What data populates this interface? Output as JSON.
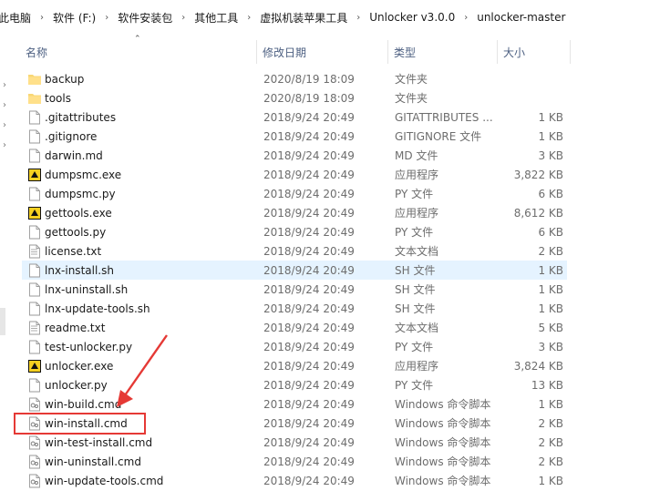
{
  "breadcrumb": [
    "此电脑",
    "软件 (F:)",
    "软件安装包",
    "其他工具",
    "虚拟机装苹果工具",
    "Unlocker v3.0.0",
    "unlocker-master"
  ],
  "columns": {
    "name": "名称",
    "date": "修改日期",
    "type": "类型",
    "size": "大小"
  },
  "files": [
    {
      "name": "backup",
      "date": "2020/8/19 18:09",
      "type": "文件夹",
      "size": "",
      "icon": "folder-icon"
    },
    {
      "name": "tools",
      "date": "2020/8/19 18:09",
      "type": "文件夹",
      "size": "",
      "icon": "folder-icon"
    },
    {
      "name": ".gitattributes",
      "date": "2018/9/24 20:49",
      "type": "GITATTRIBUTES ...",
      "size": "1 KB",
      "icon": "file-icon"
    },
    {
      "name": ".gitignore",
      "date": "2018/9/24 20:49",
      "type": "GITIGNORE 文件",
      "size": "1 KB",
      "icon": "file-icon"
    },
    {
      "name": "darwin.md",
      "date": "2018/9/24 20:49",
      "type": "MD 文件",
      "size": "3 KB",
      "icon": "file-icon"
    },
    {
      "name": "dumpsmc.exe",
      "date": "2018/9/24 20:49",
      "type": "应用程序",
      "size": "3,822 KB",
      "icon": "exe-icon"
    },
    {
      "name": "dumpsmc.py",
      "date": "2018/9/24 20:49",
      "type": "PY 文件",
      "size": "6 KB",
      "icon": "file-icon"
    },
    {
      "name": "gettools.exe",
      "date": "2018/9/24 20:49",
      "type": "应用程序",
      "size": "8,612 KB",
      "icon": "exe-icon"
    },
    {
      "name": "gettools.py",
      "date": "2018/9/24 20:49",
      "type": "PY 文件",
      "size": "6 KB",
      "icon": "file-icon"
    },
    {
      "name": "license.txt",
      "date": "2018/9/24 20:49",
      "type": "文本文档",
      "size": "2 KB",
      "icon": "text-file-icon"
    },
    {
      "name": "lnx-install.sh",
      "date": "2018/9/24 20:49",
      "type": "SH 文件",
      "size": "1 KB",
      "icon": "file-icon",
      "state": "hover"
    },
    {
      "name": "lnx-uninstall.sh",
      "date": "2018/9/24 20:49",
      "type": "SH 文件",
      "size": "1 KB",
      "icon": "file-icon"
    },
    {
      "name": "lnx-update-tools.sh",
      "date": "2018/9/24 20:49",
      "type": "SH 文件",
      "size": "1 KB",
      "icon": "file-icon"
    },
    {
      "name": "readme.txt",
      "date": "2018/9/24 20:49",
      "type": "文本文档",
      "size": "5 KB",
      "icon": "text-file-icon"
    },
    {
      "name": "test-unlocker.py",
      "date": "2018/9/24 20:49",
      "type": "PY 文件",
      "size": "3 KB",
      "icon": "file-icon"
    },
    {
      "name": "unlocker.exe",
      "date": "2018/9/24 20:49",
      "type": "应用程序",
      "size": "3,824 KB",
      "icon": "exe-icon"
    },
    {
      "name": "unlocker.py",
      "date": "2018/9/24 20:49",
      "type": "PY 文件",
      "size": "13 KB",
      "icon": "file-icon"
    },
    {
      "name": "win-build.cmd",
      "date": "2018/9/24 20:49",
      "type": "Windows 命令脚本",
      "size": "1 KB",
      "icon": "cmd-file-icon"
    },
    {
      "name": "win-install.cmd",
      "date": "2018/9/24 20:49",
      "type": "Windows 命令脚本",
      "size": "2 KB",
      "icon": "cmd-file-icon"
    },
    {
      "name": "win-test-install.cmd",
      "date": "2018/9/24 20:49",
      "type": "Windows 命令脚本",
      "size": "2 KB",
      "icon": "cmd-file-icon"
    },
    {
      "name": "win-uninstall.cmd",
      "date": "2018/9/24 20:49",
      "type": "Windows 命令脚本",
      "size": "2 KB",
      "icon": "cmd-file-icon"
    },
    {
      "name": "win-update-tools.cmd",
      "date": "2018/9/24 20:49",
      "type": "Windows 命令脚本",
      "size": "1 KB",
      "icon": "cmd-file-icon"
    }
  ],
  "colors": {
    "folder": "#f8d775",
    "selection": "#cce8ff",
    "highlight": "#e53935",
    "header_text": "#4d6082"
  },
  "icons": {
    "sort": "sort-up-icon",
    "crumb_separator": "chevron-right-icon",
    "nav_expand": "chevron-right-icon"
  }
}
